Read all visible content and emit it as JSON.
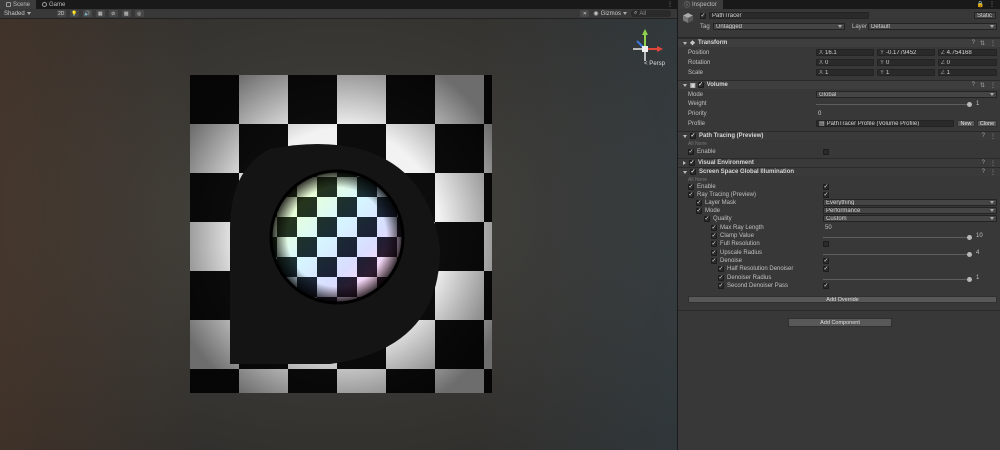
{
  "scene_tabs": [
    {
      "label": "Scene",
      "icon": "scene-icon"
    },
    {
      "label": "Game",
      "icon": "game-icon"
    }
  ],
  "toolbar": {
    "shading_mode": "Shaded",
    "mode_2d": "2D",
    "gizmos": "Gizmos",
    "search_all": "All"
  },
  "scene": {
    "persp_label": "< Persp"
  },
  "inspector": {
    "tab_label": "Inspector",
    "object_name": "PathTracer",
    "static_label": "Static",
    "tag_label": "Tag",
    "tag_value": "Untagged",
    "layer_label": "Layer",
    "layer_value": "Default",
    "transform": {
      "title": "Transform",
      "position_label": "Position",
      "position": {
        "x": "16.1",
        "y": "-0.1779452",
        "z": "4.754168"
      },
      "rotation_label": "Rotation",
      "rotation": {
        "x": "0",
        "y": "0",
        "z": "0"
      },
      "scale_label": "Scale",
      "scale": {
        "x": "1",
        "y": "1",
        "z": "1"
      }
    },
    "volume": {
      "title": "Volume",
      "mode_label": "Mode",
      "mode_value": "Global",
      "weight_label": "Weight",
      "weight_value": "1",
      "priority_label": "Priority",
      "priority_value": "0",
      "profile_label": "Profile",
      "profile_value": "PathTracer Profile (Volume Profile)",
      "new_label": "New",
      "clone_label": "Clone"
    },
    "path_tracing": {
      "title": "Path Tracing (Preview)",
      "all_none": "All None",
      "enable_label": "Enable"
    },
    "visual_environment": {
      "title": "Visual Environment"
    },
    "ssgi": {
      "title": "Screen Space Global Illumination",
      "all_none": "All None",
      "enable_label": "Enable",
      "ray_tracing_label": "Ray Tracing (Preview)",
      "layer_mask_label": "Layer Mask",
      "layer_mask_value": "Everything",
      "mode_label": "Mode",
      "mode_value": "Performance",
      "quality_label": "Quality",
      "quality_value": "Custom",
      "max_ray_label": "Max Ray Length",
      "max_ray_value": "50",
      "clamp_label": "Clamp Value",
      "clamp_value": "10",
      "full_res_label": "Full Resolution",
      "upscale_label": "Upscale Radius",
      "upscale_value": "4",
      "denoise_label": "Denoise",
      "half_res_label": "Half Resolution Denoiser",
      "denoiser_radius_label": "Denoiser Radius",
      "denoiser_radius_value": "1",
      "second_pass_label": "Second Denoiser Pass"
    },
    "add_override_label": "Add Override",
    "add_component_label": "Add Component"
  }
}
